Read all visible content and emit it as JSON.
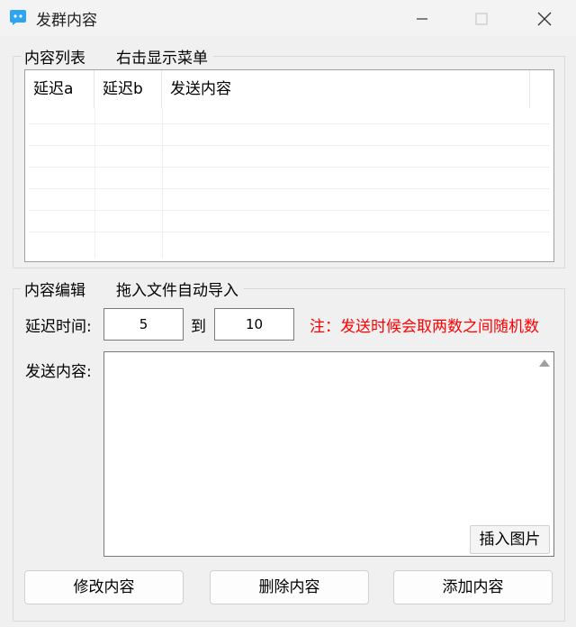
{
  "window": {
    "title": "发群内容"
  },
  "list_group": {
    "legend": "内容列表",
    "hint": "右击显示菜单",
    "columns": [
      "延迟a",
      "延迟b",
      "发送内容"
    ],
    "rows": []
  },
  "edit_group": {
    "legend": "内容编辑",
    "hint": "拖入文件自动导入",
    "delay_label": "延迟时间:",
    "delay_min": "5",
    "to_label": "到",
    "delay_max": "10",
    "note": "注：发送时候会取两数之间随机数",
    "content_label": "发送内容:",
    "content_value": "",
    "insert_image_label": "插入图片"
  },
  "buttons": {
    "modify": "修改内容",
    "delete": "删除内容",
    "add": "添加内容"
  },
  "colors": {
    "note": "#ff0000",
    "app_icon": "#2ea5f0"
  },
  "icons": [
    "app-logo-icon",
    "minimize-icon",
    "maximize-icon",
    "close-icon",
    "scroll-up-arrow-icon"
  ]
}
